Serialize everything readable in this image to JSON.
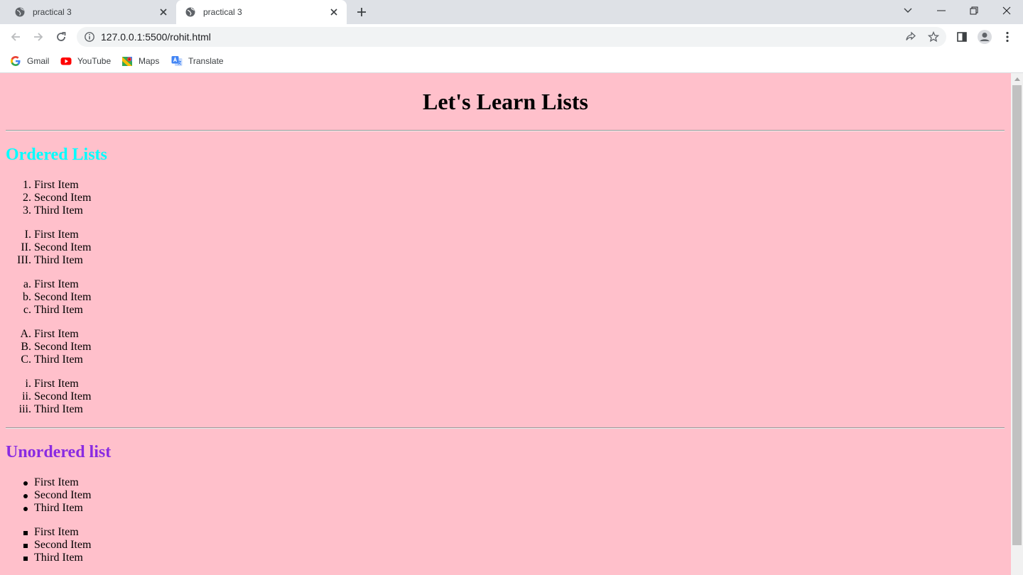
{
  "browser": {
    "tabs": [
      {
        "title": "practical 3",
        "active": false
      },
      {
        "title": "practical 3",
        "active": true
      }
    ],
    "url": "127.0.0.1:5500/rohit.html",
    "bookmarks": [
      {
        "label": "Gmail",
        "icon": "google-icon"
      },
      {
        "label": "YouTube",
        "icon": "youtube-icon"
      },
      {
        "label": "Maps",
        "icon": "maps-icon"
      },
      {
        "label": "Translate",
        "icon": "translate-icon"
      }
    ]
  },
  "page": {
    "background": "#ffc0cb",
    "title": "Let's Learn Lists",
    "ordered_heading": "Ordered Lists",
    "ordered_heading_color": "#00ffff",
    "ordered_lists": [
      {
        "type": "1",
        "items": [
          {
            "marker": "1.",
            "text": "First Item"
          },
          {
            "marker": "2.",
            "text": "Second Item"
          },
          {
            "marker": "3.",
            "text": "Third Item"
          }
        ]
      },
      {
        "type": "I",
        "items": [
          {
            "marker": "I.",
            "text": "First Item"
          },
          {
            "marker": "II.",
            "text": "Second Item"
          },
          {
            "marker": "III.",
            "text": "Third Item"
          }
        ]
      },
      {
        "type": "a",
        "items": [
          {
            "marker": "a.",
            "text": "First Item"
          },
          {
            "marker": "b.",
            "text": "Second Item"
          },
          {
            "marker": "c.",
            "text": "Third Item"
          }
        ]
      },
      {
        "type": "A",
        "items": [
          {
            "marker": "A.",
            "text": "First Item"
          },
          {
            "marker": "B.",
            "text": "Second Item"
          },
          {
            "marker": "C.",
            "text": "Third Item"
          }
        ]
      },
      {
        "type": "i",
        "items": [
          {
            "marker": "i.",
            "text": "First Item"
          },
          {
            "marker": "ii.",
            "text": "Second Item"
          },
          {
            "marker": "iii.",
            "text": "Third Item"
          }
        ]
      }
    ],
    "unordered_heading": "Unordered list",
    "unordered_heading_color": "#8a2be2",
    "unordered_lists": [
      {
        "type": "disc",
        "items": [
          "First Item",
          "Second Item",
          "Third Item"
        ]
      },
      {
        "type": "square",
        "items": [
          "First Item",
          "Second Item",
          "Third Item"
        ]
      }
    ]
  }
}
